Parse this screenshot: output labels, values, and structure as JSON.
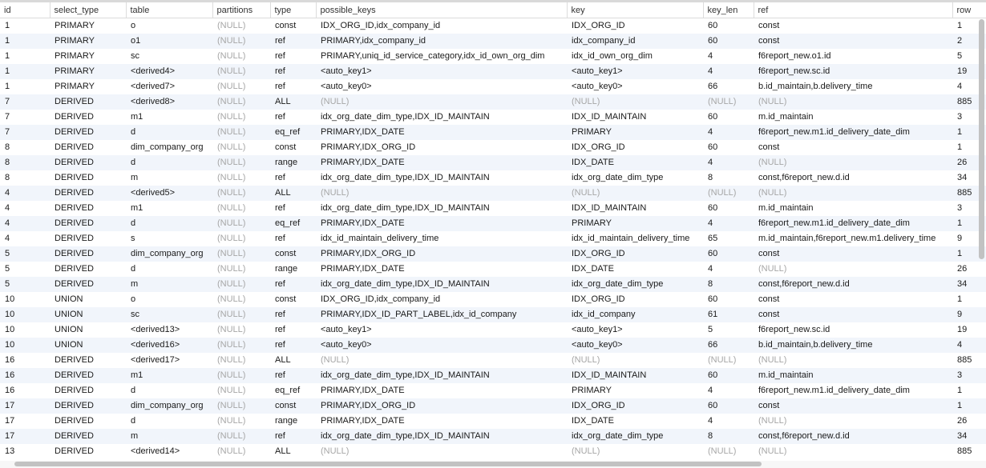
{
  "columns": [
    "id",
    "select_type",
    "table",
    "partitions",
    "type",
    "possible_keys",
    "key",
    "key_len",
    "ref",
    "row"
  ],
  "rows": [
    [
      "1",
      "PRIMARY",
      "o",
      "(NULL)",
      "const",
      "IDX_ORG_ID,idx_company_id",
      "IDX_ORG_ID",
      "60",
      "const",
      "1"
    ],
    [
      "1",
      "PRIMARY",
      "o1",
      "(NULL)",
      "ref",
      "PRIMARY,idx_company_id",
      "idx_company_id",
      "60",
      "const",
      "2"
    ],
    [
      "1",
      "PRIMARY",
      "sc",
      "(NULL)",
      "ref",
      "PRIMARY,uniq_id_service_category,idx_id_own_org_dim",
      "idx_id_own_org_dim",
      "4",
      "f6report_new.o1.id",
      "5"
    ],
    [
      "1",
      "PRIMARY",
      "<derived4>",
      "(NULL)",
      "ref",
      "<auto_key1>",
      "<auto_key1>",
      "4",
      "f6report_new.sc.id",
      "19"
    ],
    [
      "1",
      "PRIMARY",
      "<derived7>",
      "(NULL)",
      "ref",
      "<auto_key0>",
      "<auto_key0>",
      "66",
      "b.id_maintain,b.delivery_time",
      "4"
    ],
    [
      "7",
      "DERIVED",
      "<derived8>",
      "(NULL)",
      "ALL",
      "(NULL)",
      "(NULL)",
      "(NULL)",
      "(NULL)",
      "885"
    ],
    [
      "7",
      "DERIVED",
      "m1",
      "(NULL)",
      "ref",
      "idx_org_date_dim_type,IDX_ID_MAINTAIN",
      "IDX_ID_MAINTAIN",
      "60",
      "m.id_maintain",
      "3"
    ],
    [
      "7",
      "DERIVED",
      "d",
      "(NULL)",
      "eq_ref",
      "PRIMARY,IDX_DATE",
      "PRIMARY",
      "4",
      "f6report_new.m1.id_delivery_date_dim",
      "1"
    ],
    [
      "8",
      "DERIVED",
      "dim_company_org",
      "(NULL)",
      "const",
      "PRIMARY,IDX_ORG_ID",
      "IDX_ORG_ID",
      "60",
      "const",
      "1"
    ],
    [
      "8",
      "DERIVED",
      "d",
      "(NULL)",
      "range",
      "PRIMARY,IDX_DATE",
      "IDX_DATE",
      "4",
      "(NULL)",
      "26"
    ],
    [
      "8",
      "DERIVED",
      "m",
      "(NULL)",
      "ref",
      "idx_org_date_dim_type,IDX_ID_MAINTAIN",
      "idx_org_date_dim_type",
      "8",
      "const,f6report_new.d.id",
      "34"
    ],
    [
      "4",
      "DERIVED",
      "<derived5>",
      "(NULL)",
      "ALL",
      "(NULL)",
      "(NULL)",
      "(NULL)",
      "(NULL)",
      "885"
    ],
    [
      "4",
      "DERIVED",
      "m1",
      "(NULL)",
      "ref",
      "idx_org_date_dim_type,IDX_ID_MAINTAIN",
      "IDX_ID_MAINTAIN",
      "60",
      "m.id_maintain",
      "3"
    ],
    [
      "4",
      "DERIVED",
      "d",
      "(NULL)",
      "eq_ref",
      "PRIMARY,IDX_DATE",
      "PRIMARY",
      "4",
      "f6report_new.m1.id_delivery_date_dim",
      "1"
    ],
    [
      "4",
      "DERIVED",
      "s",
      "(NULL)",
      "ref",
      "idx_id_maintain_delivery_time",
      "idx_id_maintain_delivery_time",
      "65",
      "m.id_maintain,f6report_new.m1.delivery_time",
      "9"
    ],
    [
      "5",
      "DERIVED",
      "dim_company_org",
      "(NULL)",
      "const",
      "PRIMARY,IDX_ORG_ID",
      "IDX_ORG_ID",
      "60",
      "const",
      "1"
    ],
    [
      "5",
      "DERIVED",
      "d",
      "(NULL)",
      "range",
      "PRIMARY,IDX_DATE",
      "IDX_DATE",
      "4",
      "(NULL)",
      "26"
    ],
    [
      "5",
      "DERIVED",
      "m",
      "(NULL)",
      "ref",
      "idx_org_date_dim_type,IDX_ID_MAINTAIN",
      "idx_org_date_dim_type",
      "8",
      "const,f6report_new.d.id",
      "34"
    ],
    [
      "10",
      "UNION",
      "o",
      "(NULL)",
      "const",
      "IDX_ORG_ID,idx_company_id",
      "IDX_ORG_ID",
      "60",
      "const",
      "1"
    ],
    [
      "10",
      "UNION",
      "sc",
      "(NULL)",
      "ref",
      "PRIMARY,IDX_ID_PART_LABEL,idx_id_company",
      "idx_id_company",
      "61",
      "const",
      "9"
    ],
    [
      "10",
      "UNION",
      "<derived13>",
      "(NULL)",
      "ref",
      "<auto_key1>",
      "<auto_key1>",
      "5",
      "f6report_new.sc.id",
      "19"
    ],
    [
      "10",
      "UNION",
      "<derived16>",
      "(NULL)",
      "ref",
      "<auto_key0>",
      "<auto_key0>",
      "66",
      "b.id_maintain,b.delivery_time",
      "4"
    ],
    [
      "16",
      "DERIVED",
      "<derived17>",
      "(NULL)",
      "ALL",
      "(NULL)",
      "(NULL)",
      "(NULL)",
      "(NULL)",
      "885"
    ],
    [
      "16",
      "DERIVED",
      "m1",
      "(NULL)",
      "ref",
      "idx_org_date_dim_type,IDX_ID_MAINTAIN",
      "IDX_ID_MAINTAIN",
      "60",
      "m.id_maintain",
      "3"
    ],
    [
      "16",
      "DERIVED",
      "d",
      "(NULL)",
      "eq_ref",
      "PRIMARY,IDX_DATE",
      "PRIMARY",
      "4",
      "f6report_new.m1.id_delivery_date_dim",
      "1"
    ],
    [
      "17",
      "DERIVED",
      "dim_company_org",
      "(NULL)",
      "const",
      "PRIMARY,IDX_ORG_ID",
      "IDX_ORG_ID",
      "60",
      "const",
      "1"
    ],
    [
      "17",
      "DERIVED",
      "d",
      "(NULL)",
      "range",
      "PRIMARY,IDX_DATE",
      "IDX_DATE",
      "4",
      "(NULL)",
      "26"
    ],
    [
      "17",
      "DERIVED",
      "m",
      "(NULL)",
      "ref",
      "idx_org_date_dim_type,IDX_ID_MAINTAIN",
      "idx_org_date_dim_type",
      "8",
      "const,f6report_new.d.id",
      "34"
    ],
    [
      "13",
      "DERIVED",
      "<derived14>",
      "(NULL)",
      "ALL",
      "(NULL)",
      "(NULL)",
      "(NULL)",
      "(NULL)",
      "885"
    ]
  ],
  "colors": {
    "row_alt": "#f1f5fb",
    "null_text": "#a6a6a6",
    "scrollbar": "#c2c2c2"
  }
}
